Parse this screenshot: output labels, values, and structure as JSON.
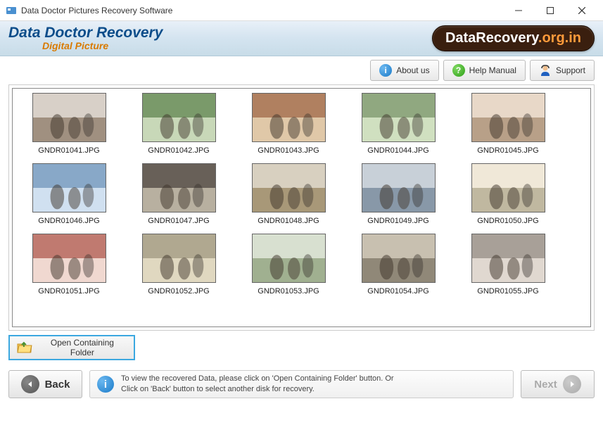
{
  "window": {
    "title": "Data Doctor Pictures Recovery Software"
  },
  "header": {
    "logo_main": "Data Doctor Recovery",
    "logo_sub": "Digital Picture",
    "site_prefix": "DataRecovery",
    "site_suffix": ".org.in"
  },
  "toolbar": {
    "about_label": "About us",
    "help_label": "Help Manual",
    "support_label": "Support"
  },
  "thumbnails": [
    {
      "filename": "GNDR01041.JPG"
    },
    {
      "filename": "GNDR01042.JPG"
    },
    {
      "filename": "GNDR01043.JPG"
    },
    {
      "filename": "GNDR01044.JPG"
    },
    {
      "filename": "GNDR01045.JPG"
    },
    {
      "filename": "GNDR01046.JPG"
    },
    {
      "filename": "GNDR01047.JPG"
    },
    {
      "filename": "GNDR01048.JPG"
    },
    {
      "filename": "GNDR01049.JPG"
    },
    {
      "filename": "GNDR01050.JPG"
    },
    {
      "filename": "GNDR01051.JPG"
    },
    {
      "filename": "GNDR01052.JPG"
    },
    {
      "filename": "GNDR01053.JPG"
    },
    {
      "filename": "GNDR01054.JPG"
    },
    {
      "filename": "GNDR01055.JPG"
    }
  ],
  "actions": {
    "open_folder_label": "Open Containing Folder"
  },
  "footer": {
    "back_label": "Back",
    "next_label": "Next",
    "info_line1": "To view the recovered Data, please click on 'Open Containing Folder' button. Or",
    "info_line2": "Click on 'Back' button to select another disk for recovery."
  }
}
